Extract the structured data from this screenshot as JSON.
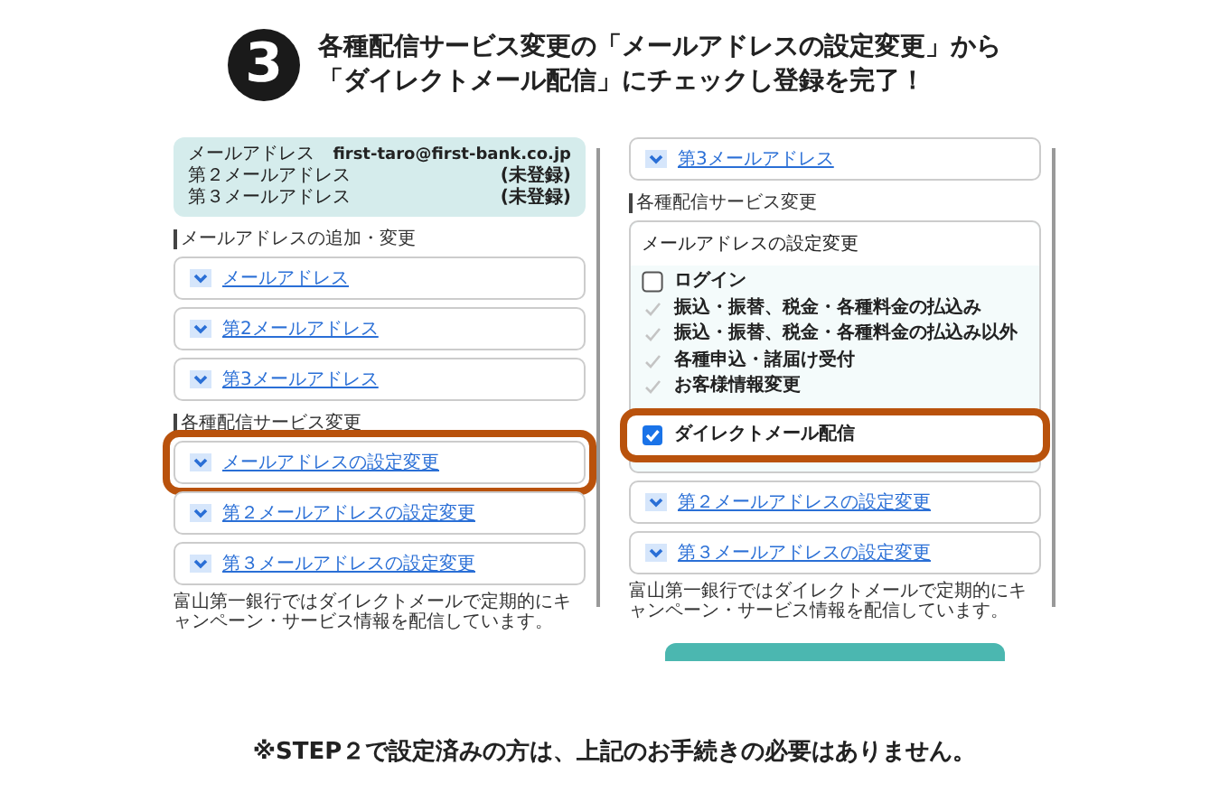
{
  "header": {
    "step": "3",
    "lines": [
      "各種配信サービス変更の「メールアドレスの設定変更」から",
      "「ダイレクトメール配信」にチェックし登録を完了！"
    ]
  },
  "left_screen": {
    "addresses": [
      {
        "label": "メールアドレス",
        "value": "first-taro@first-bank.co.jp"
      },
      {
        "label": "第２メールアドレス",
        "value": "(未登録)"
      },
      {
        "label": "第３メールアドレス",
        "value": "(未登録)"
      }
    ],
    "sections": [
      {
        "title": "メールアドレスの追加・変更",
        "items": [
          {
            "label": "メールアドレス",
            "highlighted": false
          },
          {
            "label": "第2メールアドレス",
            "highlighted": false
          },
          {
            "label": "第3メールアドレス",
            "highlighted": false
          }
        ]
      },
      {
        "title": "各種配信サービス変更",
        "items": [
          {
            "label": "メールアドレスの設定変更",
            "highlighted": true
          },
          {
            "label": "第２メールアドレスの設定変更",
            "highlighted": false
          },
          {
            "label": "第３メールアドレスの設定変更",
            "highlighted": false
          }
        ]
      }
    ],
    "note": "富山第一銀行ではダイレクトメールで定期的にキャンペーン・サービス情報を配信しています。"
  },
  "right_screen": {
    "top_item": {
      "label": "第3メールアドレス",
      "highlighted": false
    },
    "section_title": "各種配信サービス変更",
    "panel_title": "メールアドレスの設定変更",
    "options": [
      {
        "label": "ログイン",
        "checked": false,
        "disabled": false,
        "highlighted": false
      },
      {
        "label": "振込・振替、税金・各種料金の払込み",
        "checked": true,
        "disabled": true,
        "highlighted": false
      },
      {
        "label": "振込・振替、税金・各種料金の払込み以外",
        "checked": true,
        "disabled": true,
        "highlighted": false
      },
      {
        "label": "各種申込・諸届け受付",
        "checked": true,
        "disabled": true,
        "highlighted": false
      },
      {
        "label": "お客様情報変更",
        "checked": true,
        "disabled": true,
        "highlighted": false
      },
      {
        "label": "ダイレクトメール配信",
        "checked": true,
        "disabled": false,
        "highlighted": true
      }
    ],
    "items": [
      {
        "label": "第２メールアドレスの設定変更",
        "highlighted": false
      },
      {
        "label": "第３メールアドレスの設定変更",
        "highlighted": false
      }
    ],
    "note": "富山第一銀行ではダイレクトメールで定期的にキャンペーン・サービス情報を配信しています。"
  },
  "footer": "※STEP２で設定済みの方は、上記のお手続きの必要はありません。"
}
